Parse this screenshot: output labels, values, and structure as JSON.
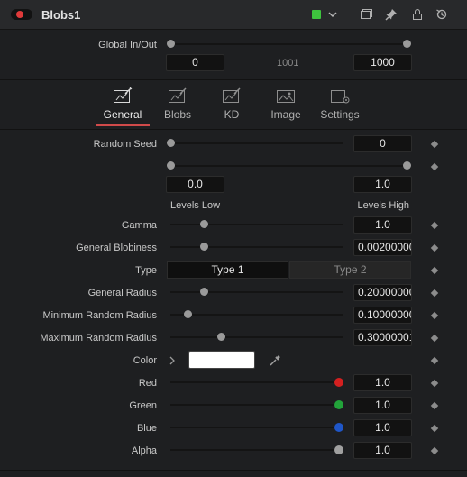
{
  "header": {
    "title": "Blobs1",
    "color_tag": "#3ec43e",
    "icons": [
      "toggle-icon",
      "color-swatch",
      "chevron-down-icon",
      "window-icon",
      "pin-icon",
      "lock-icon",
      "reset-icon"
    ]
  },
  "global": {
    "label": "Global In/Out",
    "in_value": "0",
    "mid_value": "1001",
    "out_value": "1000"
  },
  "tabs": [
    {
      "label": "General",
      "active": true
    },
    {
      "label": "Blobs",
      "active": false
    },
    {
      "label": "KD",
      "active": false
    },
    {
      "label": "Image",
      "active": false
    },
    {
      "label": "Settings",
      "active": false
    }
  ],
  "params": {
    "random_seed": {
      "label": "Random Seed",
      "value": "0"
    },
    "levels": {
      "low_value": "0.0",
      "high_value": "1.0",
      "low_label": "Levels Low",
      "high_label": "Levels High"
    },
    "gamma": {
      "label": "Gamma",
      "value": "1.0"
    },
    "general_blobiness": {
      "label": "General Blobiness",
      "value": "0.00200000"
    },
    "type": {
      "label": "Type",
      "option1": "Type 1",
      "option2": "Type 2",
      "selected": "Type 1"
    },
    "general_radius": {
      "label": "General Radius",
      "value": "0.20000000"
    },
    "min_random_radius": {
      "label": "Minimum Random Radius",
      "value": "0.10000000"
    },
    "max_random_radius": {
      "label": "Maximum Random Radius",
      "value": "0.30000001"
    },
    "color": {
      "label": "Color",
      "swatch": "#ffffff"
    },
    "red": {
      "label": "Red",
      "value": "1.0",
      "dot_color": "#d42020"
    },
    "green": {
      "label": "Green",
      "value": "1.0",
      "dot_color": "#22a33a"
    },
    "blue": {
      "label": "Blue",
      "value": "1.0",
      "dot_color": "#1f56c8"
    },
    "alpha": {
      "label": "Alpha",
      "value": "1.0",
      "dot_color": "#a0a0a0"
    }
  }
}
